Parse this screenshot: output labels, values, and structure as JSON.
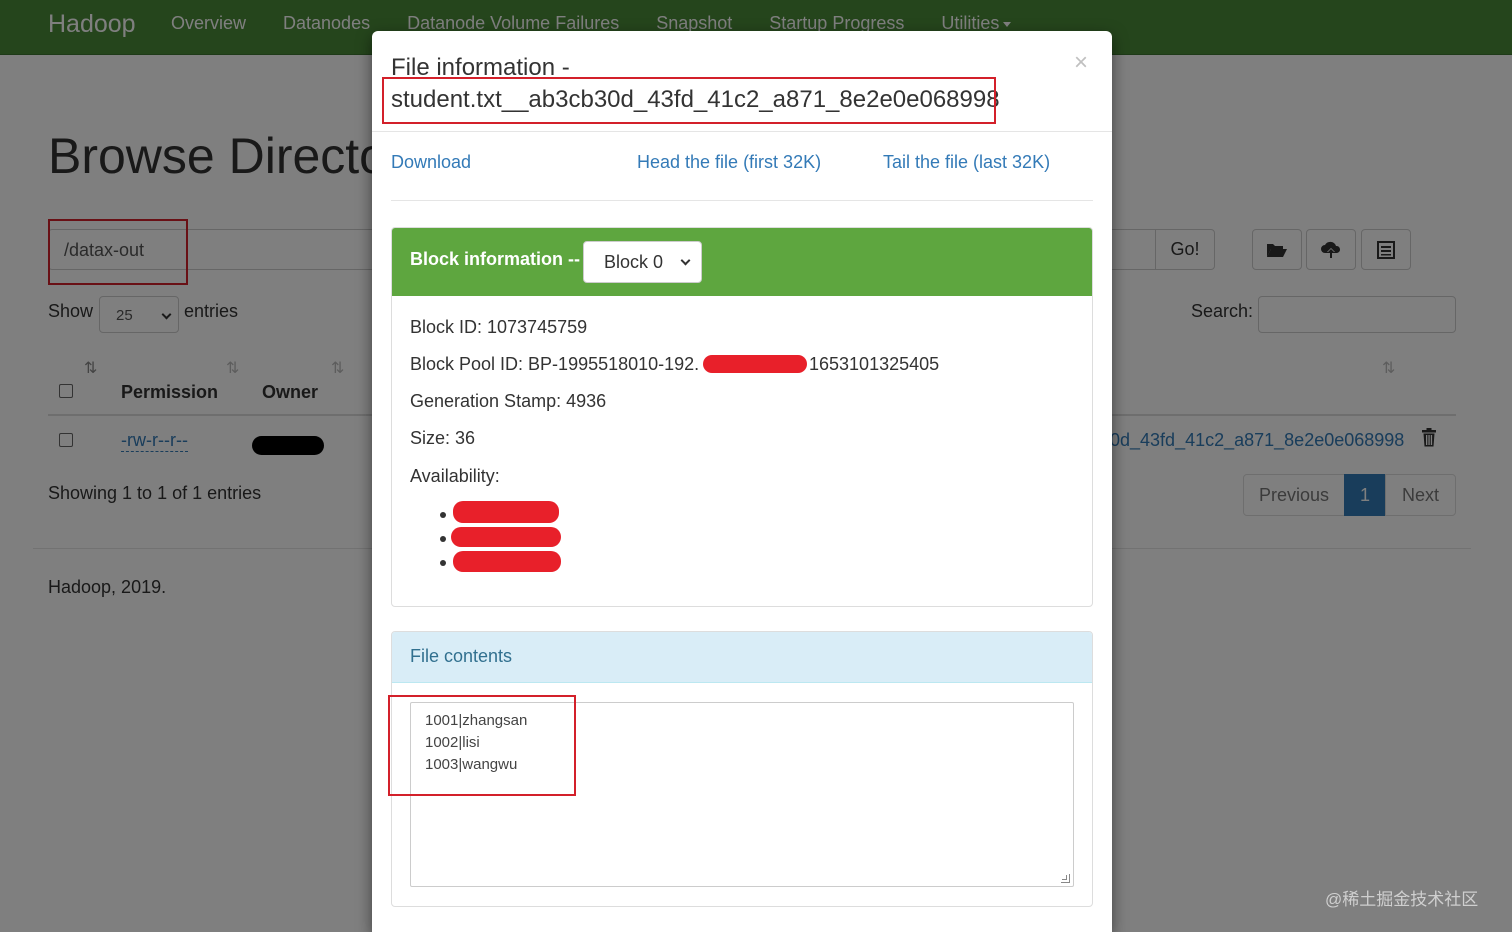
{
  "navbar": {
    "brand": "Hadoop",
    "items": [
      "Overview",
      "Datanodes",
      "Datanode Volume Failures",
      "Snapshot",
      "Startup Progress",
      "Utilities"
    ]
  },
  "page": {
    "title": "Browse Directory",
    "path_value": "/datax-out",
    "go_label": "Go!",
    "show_label": "Show",
    "entries_per_page": "25",
    "entries_label": "entries",
    "search_label": "Search:",
    "columns": [
      "Permission",
      "Owner"
    ],
    "row": {
      "permission": "-rw-r--r--",
      "name": "0d_43fd_41c2_a871_8e2e0e068998"
    },
    "showing": "Showing 1 to 1 of 1 entries",
    "pagination": {
      "previous": "Previous",
      "current": "1",
      "next": "Next"
    },
    "footer": "Hadoop, 2019."
  },
  "modal": {
    "title_prefix": "File information -",
    "file_name": "student.txt__ab3cb30d_43fd_41c2_a871_8e2e0e068998",
    "close": "×",
    "links": {
      "download": "Download",
      "head": "Head the file (first 32K)",
      "tail": "Tail the file (last 32K)"
    },
    "block_panel": {
      "title": "Block information --",
      "selected_block": "Block 0",
      "block_id": "Block ID: 1073745759",
      "pool_prefix": "Block Pool ID: BP-1995518010-192.",
      "pool_suffix": "1653101325405",
      "generation_stamp": "Generation Stamp: 4936",
      "size": "Size: 36",
      "availability": "Availability:"
    },
    "contents_panel": {
      "title": "File contents",
      "lines": [
        "1001|zhangsan",
        "1002|lisi",
        "1003|wangwu"
      ]
    }
  },
  "watermark": "@稀土掘金技术社区",
  "colors": {
    "navbar": "#4a8a38",
    "panel_success": "#5ea63f",
    "panel_info": "#d9edf7",
    "link": "#337ab7",
    "annotation": "#d3202a"
  }
}
